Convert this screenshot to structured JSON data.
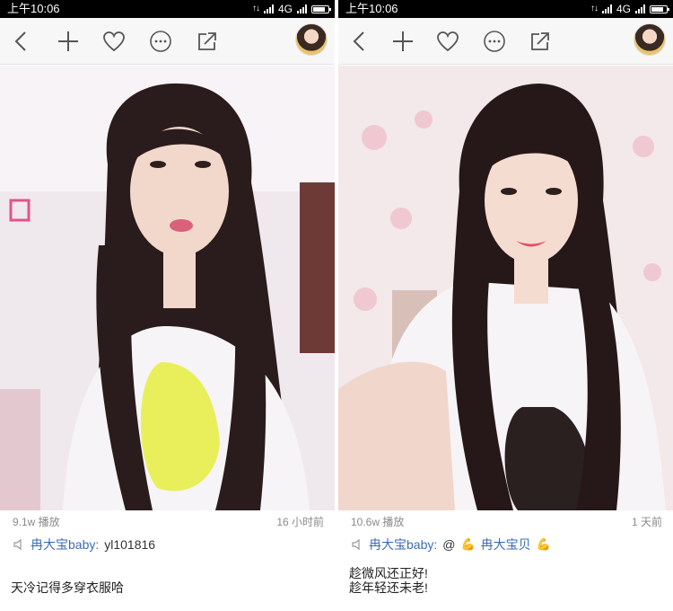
{
  "status_bar": {
    "time": "上午10:06",
    "network": "4G",
    "battery_level": 0.85
  },
  "toolbar": {
    "back_icon": "chevron-left-icon",
    "add_icon": "plus-icon",
    "like_icon": "heart-icon",
    "more_icon": "more-icon",
    "share_icon": "share-icon"
  },
  "posts": [
    {
      "plays": "9.1w 播放",
      "time_ago": "16 小时前",
      "username": "冉大宝baby:",
      "message": "yl101816",
      "text_lines": [
        "天冷记得多穿衣服哈"
      ]
    },
    {
      "plays": "10.6w 播放",
      "time_ago": "1 天前",
      "username": "冉大宝baby:",
      "message": "@",
      "mention": "冉大宝贝",
      "text_lines": [
        "趁微风还正好!",
        "趁年轻还未老!"
      ]
    }
  ],
  "colors": {
    "username": "#3a6db5",
    "meta": "#8a8a8a",
    "toolbar_bg": "#f7f7f7"
  }
}
